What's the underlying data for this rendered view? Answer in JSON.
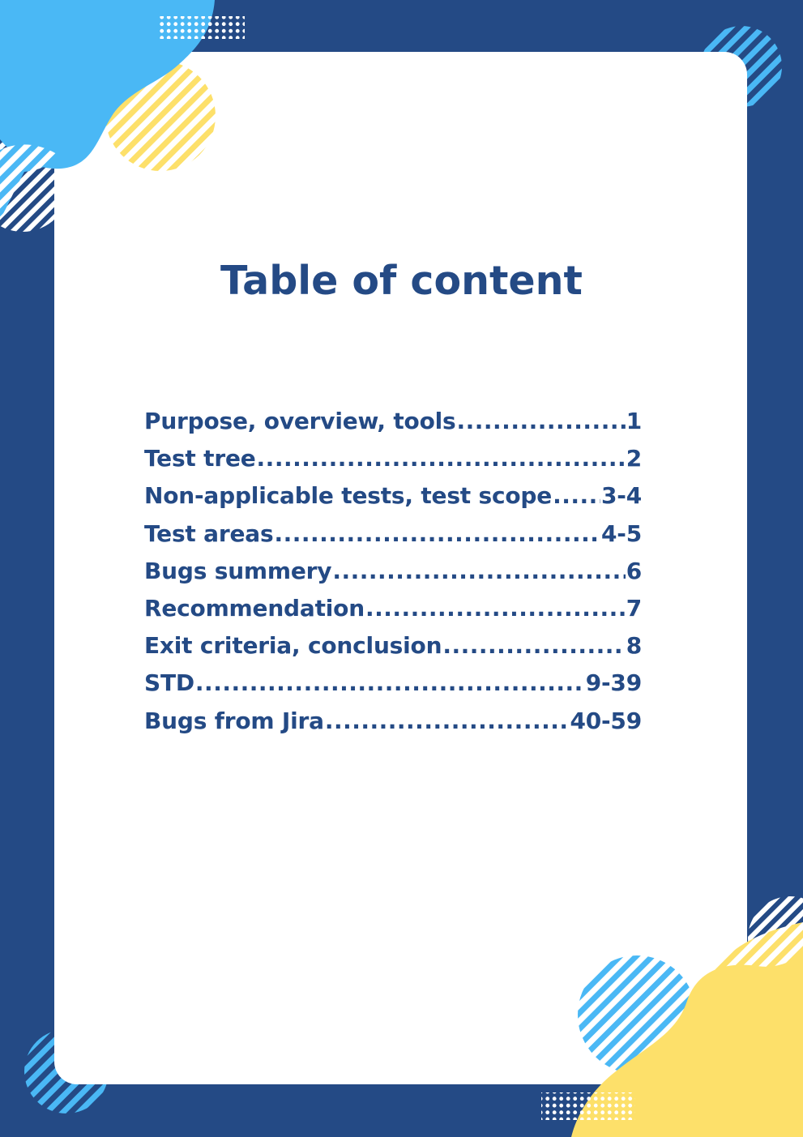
{
  "title": "Table of content",
  "toc": [
    {
      "label": "Purpose, overview, tools",
      "page": "1"
    },
    {
      "label": "Test tree",
      "page": "2"
    },
    {
      "label": "Non-applicable tests, test scope",
      "page": "3-4"
    },
    {
      "label": "Test areas",
      "page": "4-5"
    },
    {
      "label": "Bugs summery",
      "page": "6"
    },
    {
      "label": "Recommendation",
      "page": "7"
    },
    {
      "label": "Exit criteria, conclusion",
      "page": "8"
    },
    {
      "label": "STD",
      "page": "9-39"
    },
    {
      "label": "Bugs from Jira",
      "page": "40-59"
    }
  ],
  "colors": {
    "navy": "#244a85",
    "light_blue": "#4ab8f5",
    "yellow": "#fde06a",
    "white": "#ffffff"
  }
}
